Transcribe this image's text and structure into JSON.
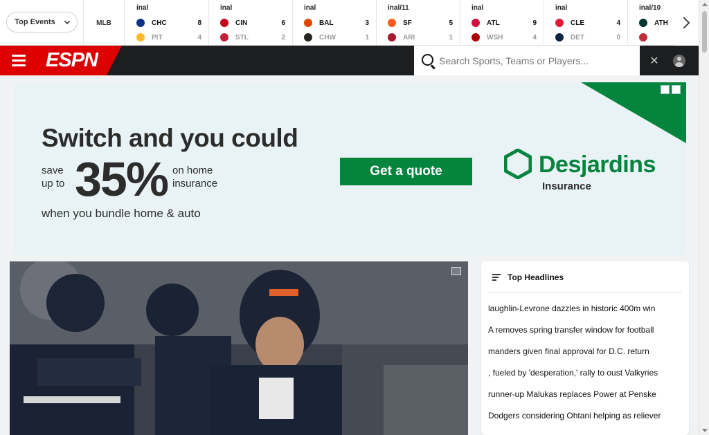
{
  "scoreboard": {
    "events_select": "Top Events",
    "league": "MLB",
    "games": [
      {
        "status": "inal",
        "team1": {
          "abbr": "CHC",
          "score": "8",
          "color": "#0e3386"
        },
        "team2": {
          "abbr": "PIT",
          "score": "4",
          "color": "#fdb827"
        }
      },
      {
        "status": "inal",
        "team1": {
          "abbr": "CIN",
          "score": "6",
          "color": "#c6011f"
        },
        "team2": {
          "abbr": "STL",
          "score": "2",
          "color": "#c41e3a"
        }
      },
      {
        "status": "inal",
        "team1": {
          "abbr": "BAL",
          "score": "3",
          "color": "#df4601"
        },
        "team2": {
          "abbr": "CHW",
          "score": "1",
          "color": "#27251f"
        }
      },
      {
        "status": "inal/11",
        "team1": {
          "abbr": "SF",
          "score": "5",
          "color": "#fd5a1e"
        },
        "team2": {
          "abbr": "ARI",
          "score": "1",
          "color": "#a71930"
        }
      },
      {
        "status": "inal",
        "team1": {
          "abbr": "ATL",
          "score": "9",
          "color": "#ce1141"
        },
        "team2": {
          "abbr": "WSH",
          "score": "4",
          "color": "#ab0003"
        }
      },
      {
        "status": "inal",
        "team1": {
          "abbr": "CLE",
          "score": "4",
          "color": "#e31937"
        },
        "team2": {
          "abbr": "DET",
          "score": "0",
          "color": "#0c2340"
        }
      },
      {
        "status": "inal/10",
        "team1": {
          "abbr": "ATH",
          "score": "",
          "color": "#003831"
        },
        "team2": {
          "abbr": "",
          "score": "",
          "color": "#bd3039"
        }
      }
    ]
  },
  "header": {
    "brand": "ESPN",
    "search_placeholder": "Search Sports, Teams or Players...",
    "close_label": "✕"
  },
  "ad": {
    "headline": "Switch and you could",
    "save": "save",
    "up_to": "up to",
    "percent": "35%",
    "on_home": "on home",
    "insurance": "insurance",
    "footer": "when you bundle home & auto",
    "cta": "Get a quote",
    "brand": "Desjardins",
    "brand_sub": "Insurance"
  },
  "headlines": {
    "title": "Top Headlines",
    "items": [
      "laughlin-Levrone dazzles in historic 400m win",
      "A removes spring transfer window for football",
      "manders given final approval for D.C. return",
      ", fueled by 'desperation,' rally to oust Valkyries",
      "runner-up Malukas replaces Power at Penske",
      "Dodgers considering Ohtani helping as reliever"
    ]
  },
  "colors": {
    "espn_red": "#dd0000",
    "header_dark": "#1d1e1f",
    "ad_green": "#05843e"
  }
}
